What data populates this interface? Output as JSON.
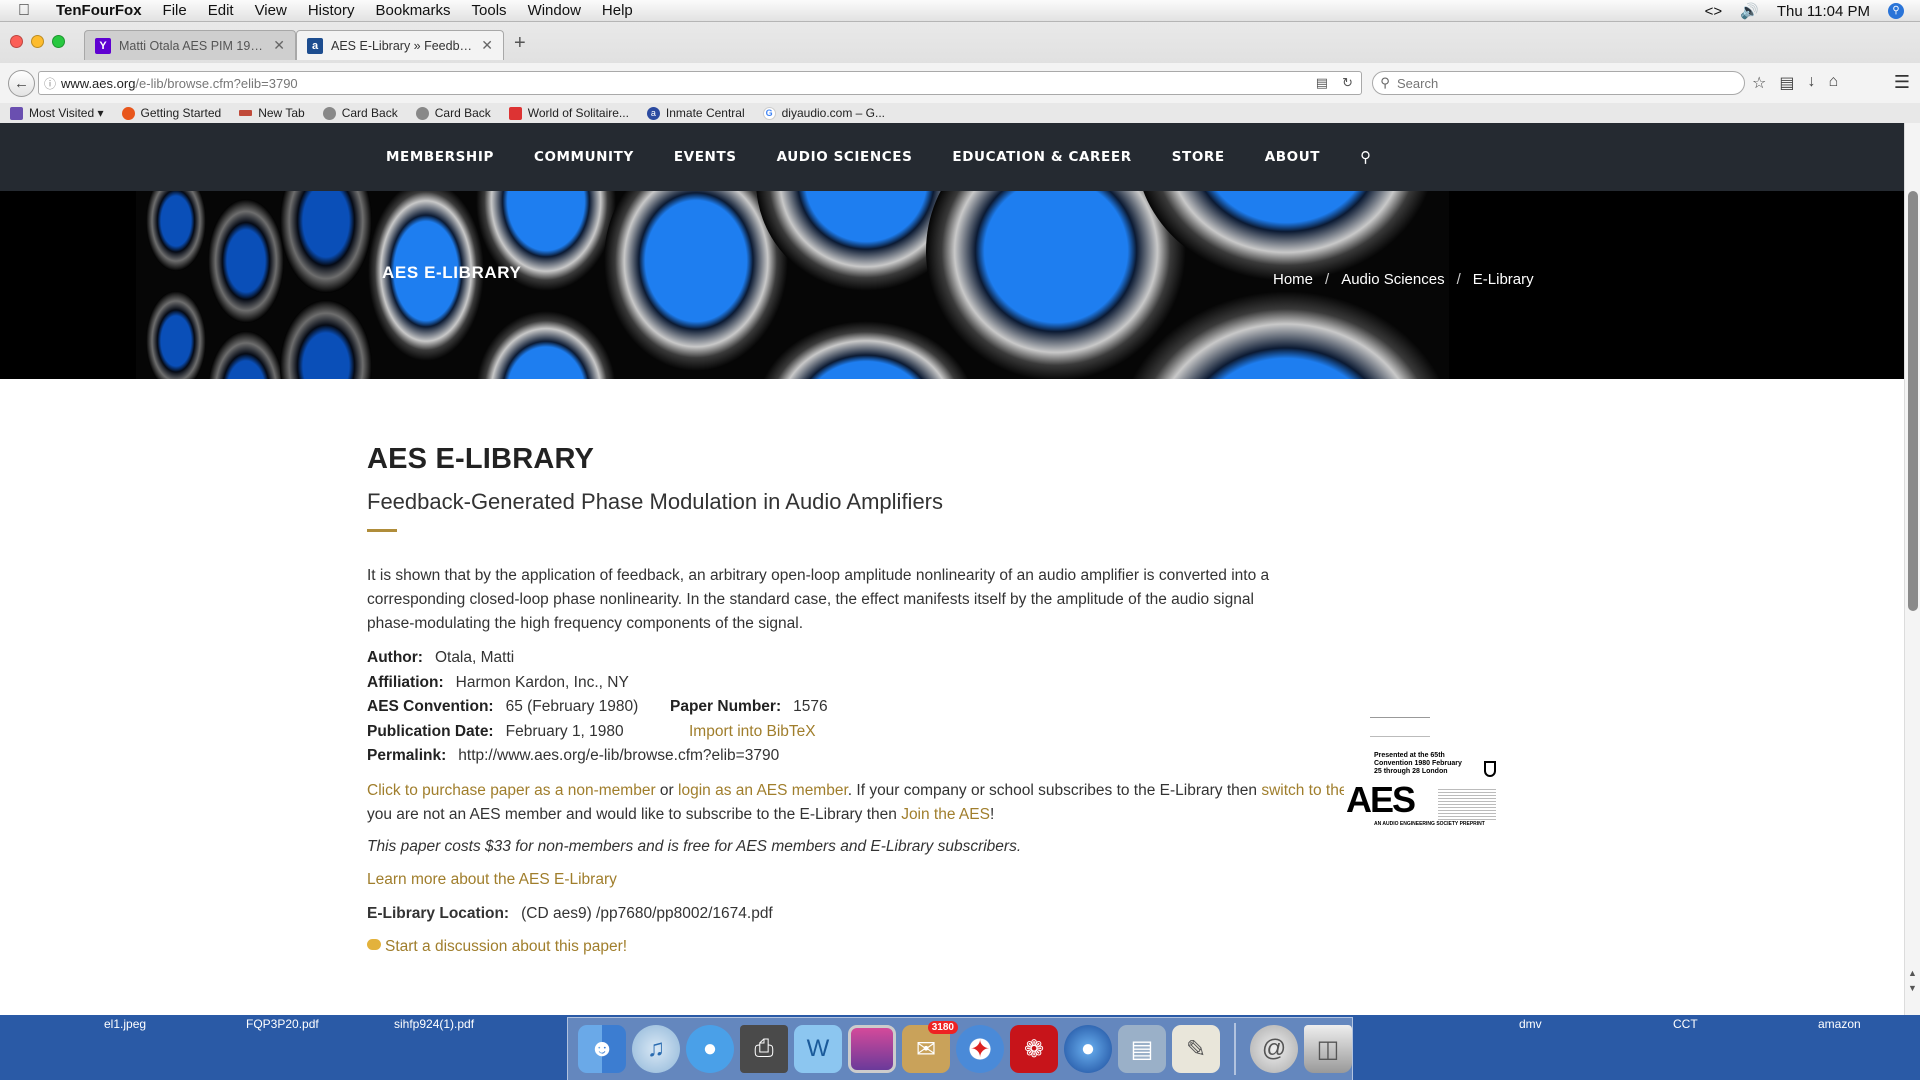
{
  "menubar": {
    "app_name": "TenFourFox",
    "items": [
      "File",
      "Edit",
      "View",
      "History",
      "Bookmarks",
      "Tools",
      "Window",
      "Help"
    ],
    "clock": "Thu 11:04 PM"
  },
  "browser": {
    "tabs": [
      {
        "label": "Matti Otala AES PIM 1980 ...",
        "favicon": "Y"
      },
      {
        "label": "AES E-Library » Feedback...",
        "favicon": "aes"
      }
    ],
    "url_host": "www.aes.org",
    "url_path": "/e-lib/browse.cfm?elib=3790",
    "search_placeholder": "Search",
    "bookmarks": [
      "Most Visited",
      "Getting Started",
      "New Tab",
      "Card Back",
      "Card Back",
      "World of Solitaire...",
      "Inmate Central",
      "diyaudio.com – G..."
    ]
  },
  "site": {
    "nav": [
      "MEMBERSHIP",
      "COMMUNITY",
      "EVENTS",
      "AUDIO SCIENCES",
      "EDUCATION & CAREER",
      "STORE",
      "ABOUT"
    ],
    "banner_title": "AES E-LIBRARY",
    "breadcrumbs": [
      "Home",
      "Audio Sciences",
      "E-Library"
    ],
    "heading": "AES E-LIBRARY",
    "paper_title": "Feedback-Generated Phase Modulation in Audio Amplifiers",
    "abstract": "It is shown that by the application of feedback, an arbitrary open-loop amplitude nonlinearity of an audio amplifier is converted into a corresponding closed-loop phase nonlinearity. In the standard case, the effect manifests itself by the amplitude of the audio signal phase-modulating the high frequency components of the signal.",
    "author_label": "Author:",
    "author": "Otala, Matti",
    "affiliation_label": "Affiliation:",
    "affiliation": "Harmon Kardon, Inc., NY",
    "convention_label": "AES Convention:",
    "convention": "65 (February 1980)",
    "paper_number_label": "Paper Number:",
    "paper_number": "1576",
    "pub_date_label": "Publication Date:",
    "pub_date": "February 1, 1980",
    "bibtex": "Import into BibTeX",
    "permalink_label": "Permalink:",
    "permalink": "http://www.aes.org/e-lib/browse.cfm?elib=3790",
    "purchase_link": "Click to purchase paper as a non-member",
    "or_text": " or ",
    "login_link": "login as an AES member",
    "subscribe_text": ". If your company or school subscribes to the E-Library then ",
    "switch_link": "switch to the institutional version",
    "not_member_text": ". If you are not an AES member and would like to subscribe to the E-Library then ",
    "join_link": "Join the AES",
    "join_end": "!",
    "cost_note": "This paper costs $33 for non-members and is free for AES members and E-Library subscribers.",
    "learn_more": "Learn more about the AES E-Library",
    "location_label": "E-Library Location:",
    "location": "(CD aes9)   /pp7680/pp8002/1674.pdf",
    "discussion": "Start a discussion about this paper!",
    "paper_thumb": {
      "presented": "Presented at the 65th Convention 1980 February 25 through 28 London",
      "logo": "AES",
      "subtitle": "AN AUDIO ENGINEERING SOCIETY PREPRINT"
    }
  },
  "desktop": {
    "files": [
      "el1.jpeg",
      "FQP3P20.pdf",
      "sihfp924(1).pdf",
      "dmv",
      "CCT",
      "amazon"
    ],
    "mail_badge": "3180"
  },
  "colors": {
    "accent_gold": "#a07e2c",
    "nav_bg": "#252a31",
    "banner_blue": "#1e7ef0"
  }
}
